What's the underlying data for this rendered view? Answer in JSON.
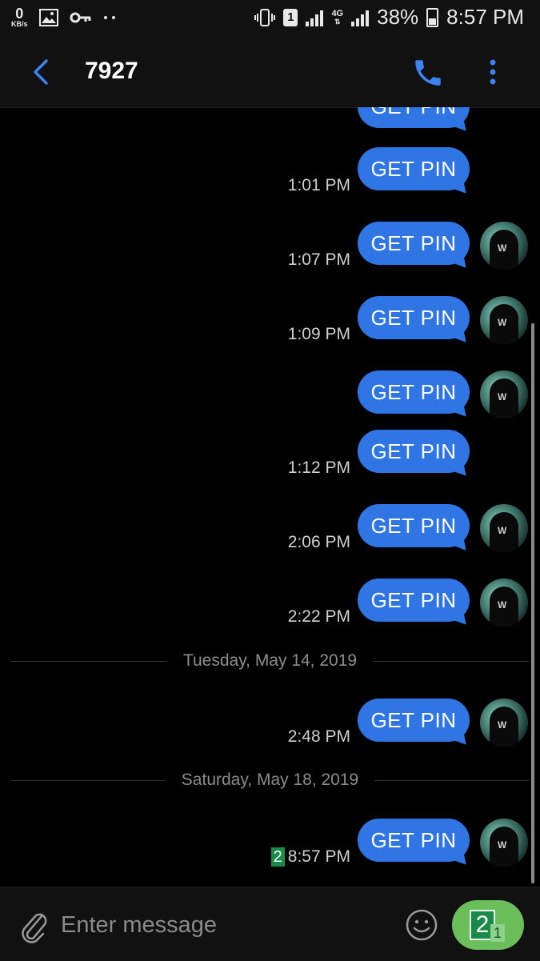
{
  "status_bar": {
    "speed_value": "0",
    "speed_unit": "KB/s",
    "sim_slot": "1",
    "network": "4G",
    "battery": "38%",
    "time": "8:57 PM",
    "icons": [
      "image-icon",
      "key-icon",
      "more-dots-icon",
      "vibrate-icon",
      "signal-icon",
      "battery-icon"
    ]
  },
  "header": {
    "title": "7927",
    "icons": [
      "back-icon",
      "phone-icon",
      "more-vert-icon"
    ]
  },
  "messages": [
    {
      "text": "GET PIN",
      "time": "",
      "avatar": false,
      "partial": true
    },
    {
      "text": "GET PIN",
      "time": "1:01 PM",
      "avatar": false
    },
    {
      "text": "GET PIN",
      "time": "1:07 PM",
      "avatar": true
    },
    {
      "text": "GET PIN",
      "time": "1:09 PM",
      "avatar": true
    },
    {
      "text": "GET PIN",
      "time": "",
      "avatar": true
    },
    {
      "text": "GET PIN",
      "time": "1:12 PM",
      "avatar": false
    },
    {
      "text": "GET PIN",
      "time": "2:06 PM",
      "avatar": true
    },
    {
      "text": "GET PIN",
      "time": "2:22 PM",
      "avatar": true
    },
    {
      "text": "GET PIN",
      "time": "2:48 PM",
      "avatar": true
    },
    {
      "text": "GET PIN",
      "time": "8:57 PM",
      "avatar": true,
      "sim_badge": "2"
    }
  ],
  "dividers": [
    "Tuesday, May 14, 2019",
    "Saturday, May 18, 2019"
  ],
  "composer": {
    "placeholder": "Enter message",
    "send_sim_large": "2",
    "send_sim_small": "1",
    "icons": [
      "attach-icon",
      "emoji-icon"
    ]
  },
  "colors": {
    "bubble": "#2f76e4",
    "accent": "#2f76e4",
    "send": "#6abf5a",
    "sim_badge": "#1a8a4a"
  }
}
